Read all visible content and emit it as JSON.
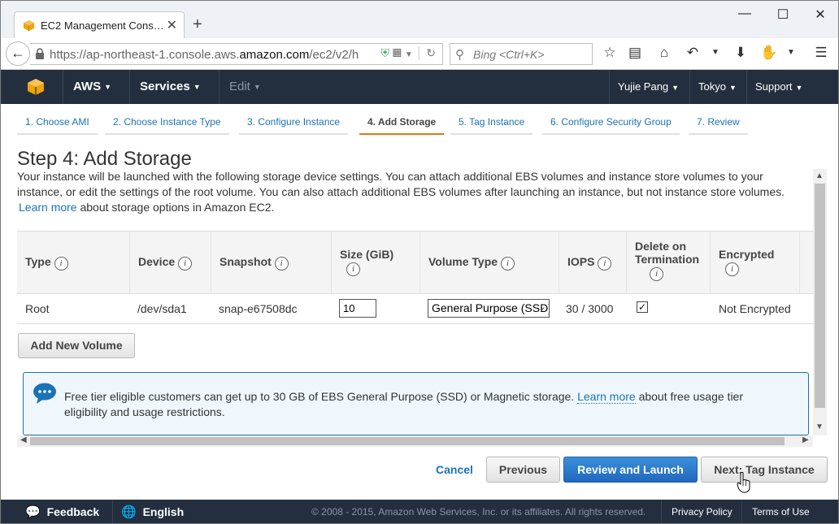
{
  "browser": {
    "tab_title": "EC2 Management Cons…",
    "url_prefix": "https://ap-northeast-1.console.aws.",
    "url_domain": "amazon.com",
    "url_suffix": "/ec2/v2/h",
    "search_placeholder": "Bing <Ctrl+K>"
  },
  "aws_header": {
    "brand": "AWS",
    "services": "Services",
    "edit": "Edit",
    "user": "Yujie Pang",
    "region": "Tokyo",
    "support": "Support"
  },
  "steps": [
    {
      "label": "1. Choose AMI",
      "active": false
    },
    {
      "label": "2. Choose Instance Type",
      "active": false
    },
    {
      "label": "3. Configure Instance",
      "active": false
    },
    {
      "label": "4. Add Storage",
      "active": true
    },
    {
      "label": "5. Tag Instance",
      "active": false
    },
    {
      "label": "6. Configure Security Group",
      "active": false
    },
    {
      "label": "7. Review",
      "active": false
    }
  ],
  "page": {
    "title": "Step 4: Add Storage",
    "description": "Your instance will be launched with the following storage device settings. You can attach additional EBS volumes and instance store volumes to your instance, or edit the settings of the root volume. You can also attach additional EBS volumes after launching an instance, but not instance store volumes.",
    "learn_more": "Learn more",
    "description_tail": "about storage options in Amazon EC2."
  },
  "table": {
    "headers": {
      "type": "Type",
      "device": "Device",
      "snapshot": "Snapshot",
      "size": "Size (GiB)",
      "volume_type": "Volume Type",
      "iops": "IOPS",
      "delete_line1": "Delete on",
      "delete_line2": "Termination",
      "encrypted": "Encrypted"
    },
    "row": {
      "type": "Root",
      "device": "/dev/sda1",
      "snapshot": "snap-e67508dc",
      "size": "10",
      "volume_type": "General Purpose (SSD)",
      "iops": "30 / 3000",
      "delete_on_termination": true,
      "encrypted": "Not Encrypted"
    }
  },
  "add_volume_label": "Add New Volume",
  "info": {
    "text": "Free tier eligible customers can get up to 30 GB of EBS General Purpose (SSD) or Magnetic storage.",
    "learn_more": "Learn more",
    "tail": "about free usage tier eligibility and usage restrictions."
  },
  "actions": {
    "cancel": "Cancel",
    "previous": "Previous",
    "review_launch": "Review and Launch",
    "next": "Next: Tag Instance"
  },
  "footer": {
    "feedback": "Feedback",
    "language": "English",
    "copyright": "© 2008 - 2015, Amazon Web Services, Inc. or its affiliates. All rights reserved.",
    "privacy": "Privacy Policy",
    "terms": "Terms of Use"
  },
  "colors": {
    "aws_dark": "#232f3e",
    "link": "#1a73b8",
    "active_step": "#e47911",
    "primary_button": "#2068bf"
  }
}
